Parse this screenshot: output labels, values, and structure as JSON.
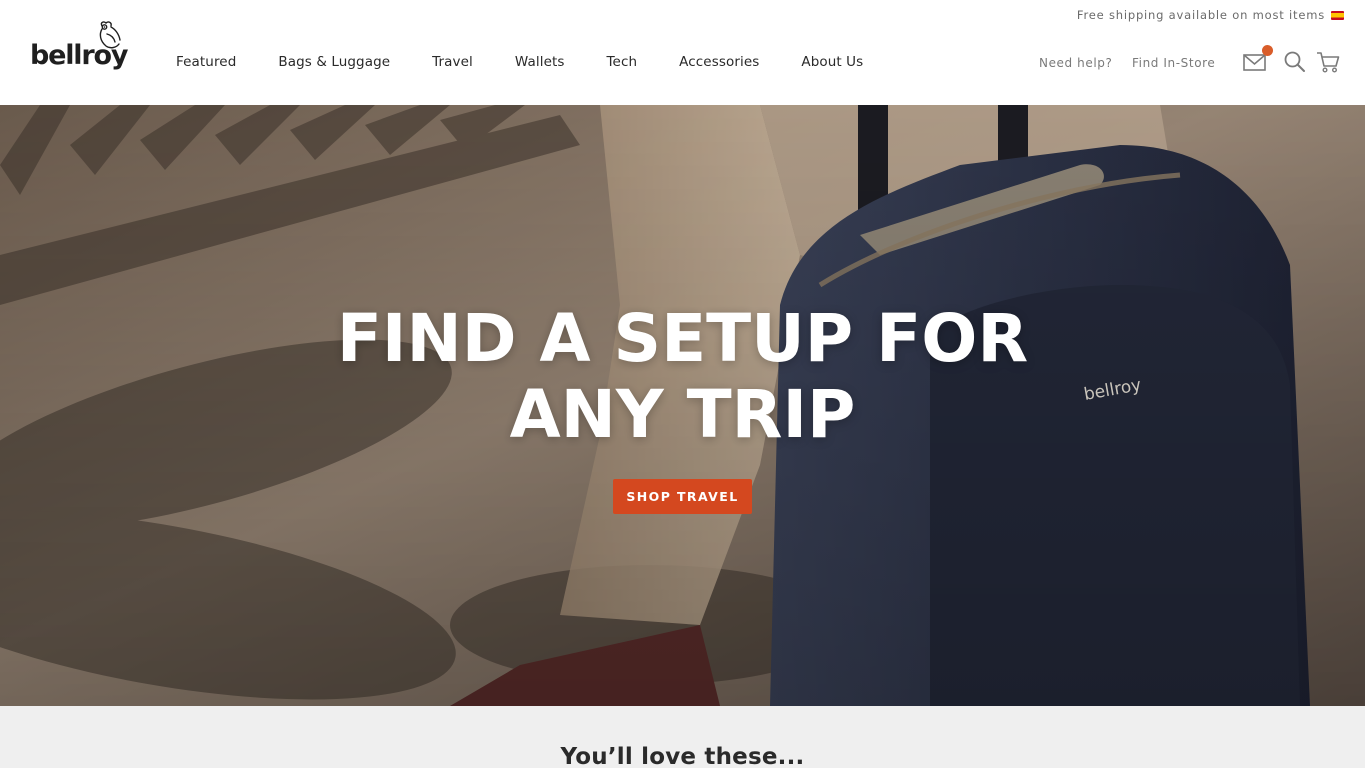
{
  "header": {
    "promo_text": "Free shipping available on most items",
    "flag_icon": "spain-flag-icon",
    "logo_text": "bellroy",
    "nav": [
      {
        "label": "Featured"
      },
      {
        "label": "Bags & Luggage"
      },
      {
        "label": "Travel"
      },
      {
        "label": "Wallets"
      },
      {
        "label": "Tech"
      },
      {
        "label": "Accessories"
      },
      {
        "label": "About Us"
      }
    ],
    "need_help": "Need help?",
    "find_store": "Find In-Store",
    "icons": [
      "mail-icon",
      "search-icon",
      "cart-icon"
    ],
    "notification_color": "#d95d2a"
  },
  "hero": {
    "title_line1": "FIND A SETUP FOR",
    "title_line2": "ANY TRIP",
    "cta_label": "SHOP TRAVEL",
    "cta_color": "#d4481f",
    "suitcase_brand": "bellroy"
  },
  "section": {
    "title": "You’ll love these..."
  }
}
